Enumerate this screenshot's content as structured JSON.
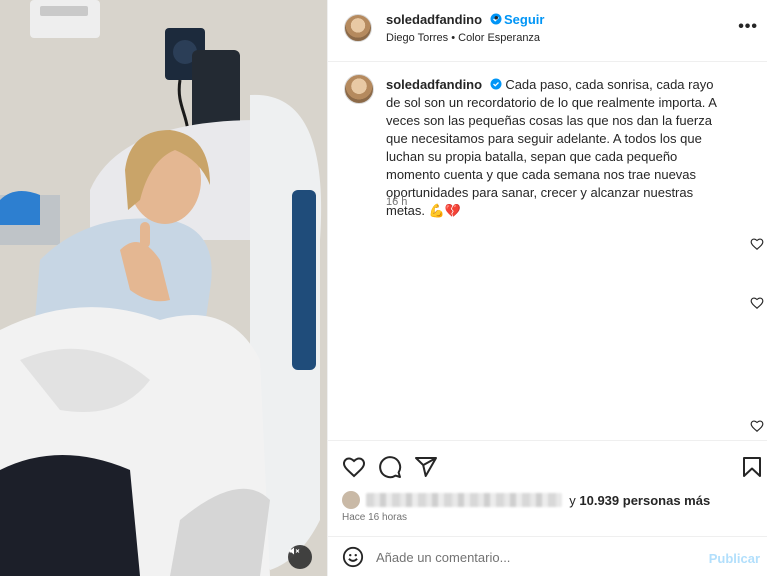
{
  "post": {
    "username": "soledadfandino",
    "follow_label": "Seguir",
    "separator": "•",
    "music": "Diego Torres • Color Esperanza",
    "more_icon": "more-horizontal-icon",
    "more_label": "•••"
  },
  "caption": {
    "username": "soledadfandino",
    "text": "Cada paso, cada sonrisa, cada rayo de sol son un recordatorio de lo que realmente importa. A veces son las pequeñas cosas las que nos dan la fuerza que necesitamos para seguir adelante. A todos los que luchan su propia batalla, sepan que cada pequeño momento cuenta y que cada semana nos trae nuevas oportunidades para sanar, crecer y alcanzar nuestras metas.",
    "emojis": "💪💔",
    "time": "16 h"
  },
  "engagement": {
    "likes_prefix": "y ",
    "likes_count": "10.939",
    "likes_suffix": " personas más",
    "date": "Hace 16 horas"
  },
  "comment": {
    "placeholder": "Añade un comentario...",
    "publish_label": "Publicar"
  },
  "colors": {
    "accent": "#0095f6",
    "publish_disabled": "#b2dffc",
    "verified": "#0095f6"
  },
  "icons": {
    "like": "heart-icon",
    "comment": "comment-icon",
    "share": "share-icon",
    "save": "bookmark-icon",
    "emoji": "emoji-icon",
    "mute": "mute-icon"
  }
}
